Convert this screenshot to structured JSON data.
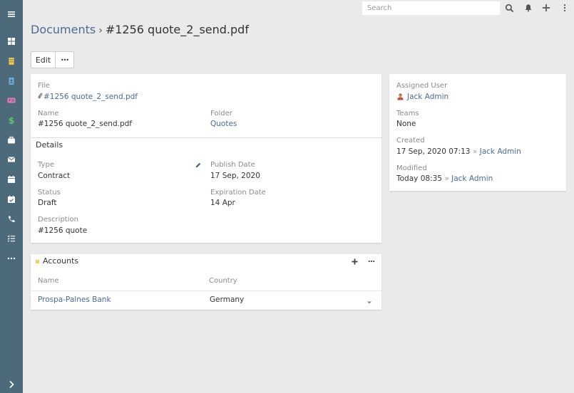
{
  "sidebar": {
    "items": [
      {
        "icon": "menu-icon"
      },
      {
        "icon": "dashboard-icon"
      },
      {
        "icon": "building-icon",
        "color": "#f5c342"
      },
      {
        "icon": "contacts-icon",
        "color": "#6fa8dc"
      },
      {
        "icon": "id-card-icon",
        "color": "#e879b9"
      },
      {
        "icon": "dollar-icon",
        "color": "#5cc76c"
      },
      {
        "icon": "briefcase-icon"
      },
      {
        "icon": "envelope-icon"
      },
      {
        "icon": "calendar-icon"
      },
      {
        "icon": "calendar-check-icon"
      },
      {
        "icon": "phone-icon"
      },
      {
        "icon": "tasks-icon"
      },
      {
        "icon": "more-icon"
      },
      {
        "icon": "expand-icon"
      }
    ]
  },
  "topbar": {
    "search_placeholder": "Search",
    "icons": [
      "search-icon",
      "bell-icon",
      "plus-icon",
      "kebab-icon"
    ]
  },
  "breadcrumb": {
    "parent": "Documents",
    "separator": "›",
    "current": "#1256 quote_2_send.pdf"
  },
  "actions": {
    "edit_label": "Edit",
    "more_label": "•••"
  },
  "main_panel": {
    "file_label": "File",
    "file_value": "#1256 quote_2_send.pdf",
    "name_label": "Name",
    "name_value": "#1256 quote_2_send.pdf",
    "folder_label": "Folder",
    "folder_value": "Quotes",
    "details_title": "Details",
    "type_label": "Type",
    "type_value": "Contract",
    "publish_label": "Publish Date",
    "publish_value": "17 Sep, 2020",
    "status_label": "Status",
    "status_value": "Draft",
    "expiration_label": "Expiration Date",
    "expiration_value": "14 Apr",
    "description_label": "Description",
    "description_value": "#1256 quote"
  },
  "side_panel": {
    "assigned_label": "Assigned User",
    "assigned_value": "Jack Admin",
    "teams_label": "Teams",
    "teams_value": "None",
    "created_label": "Created",
    "created_date": "17 Sep, 2020 07:13",
    "created_by": "Jack Admin",
    "modified_label": "Modified",
    "modified_date": "Today 08:35",
    "modified_by": "Jack Admin",
    "by_separator": "»"
  },
  "accounts_panel": {
    "title": "Accounts",
    "title_square_color": "#f0d264",
    "add_label": "+",
    "more_label": "•••",
    "columns": [
      "Name",
      "Country"
    ],
    "rows": [
      {
        "name": "Prospa-Palnes Bank",
        "country": "Germany"
      }
    ]
  },
  "colors": {
    "sidebar_bg": "#4d6a7a",
    "link": "#4d6a93",
    "page_bg": "#eaeaea"
  }
}
